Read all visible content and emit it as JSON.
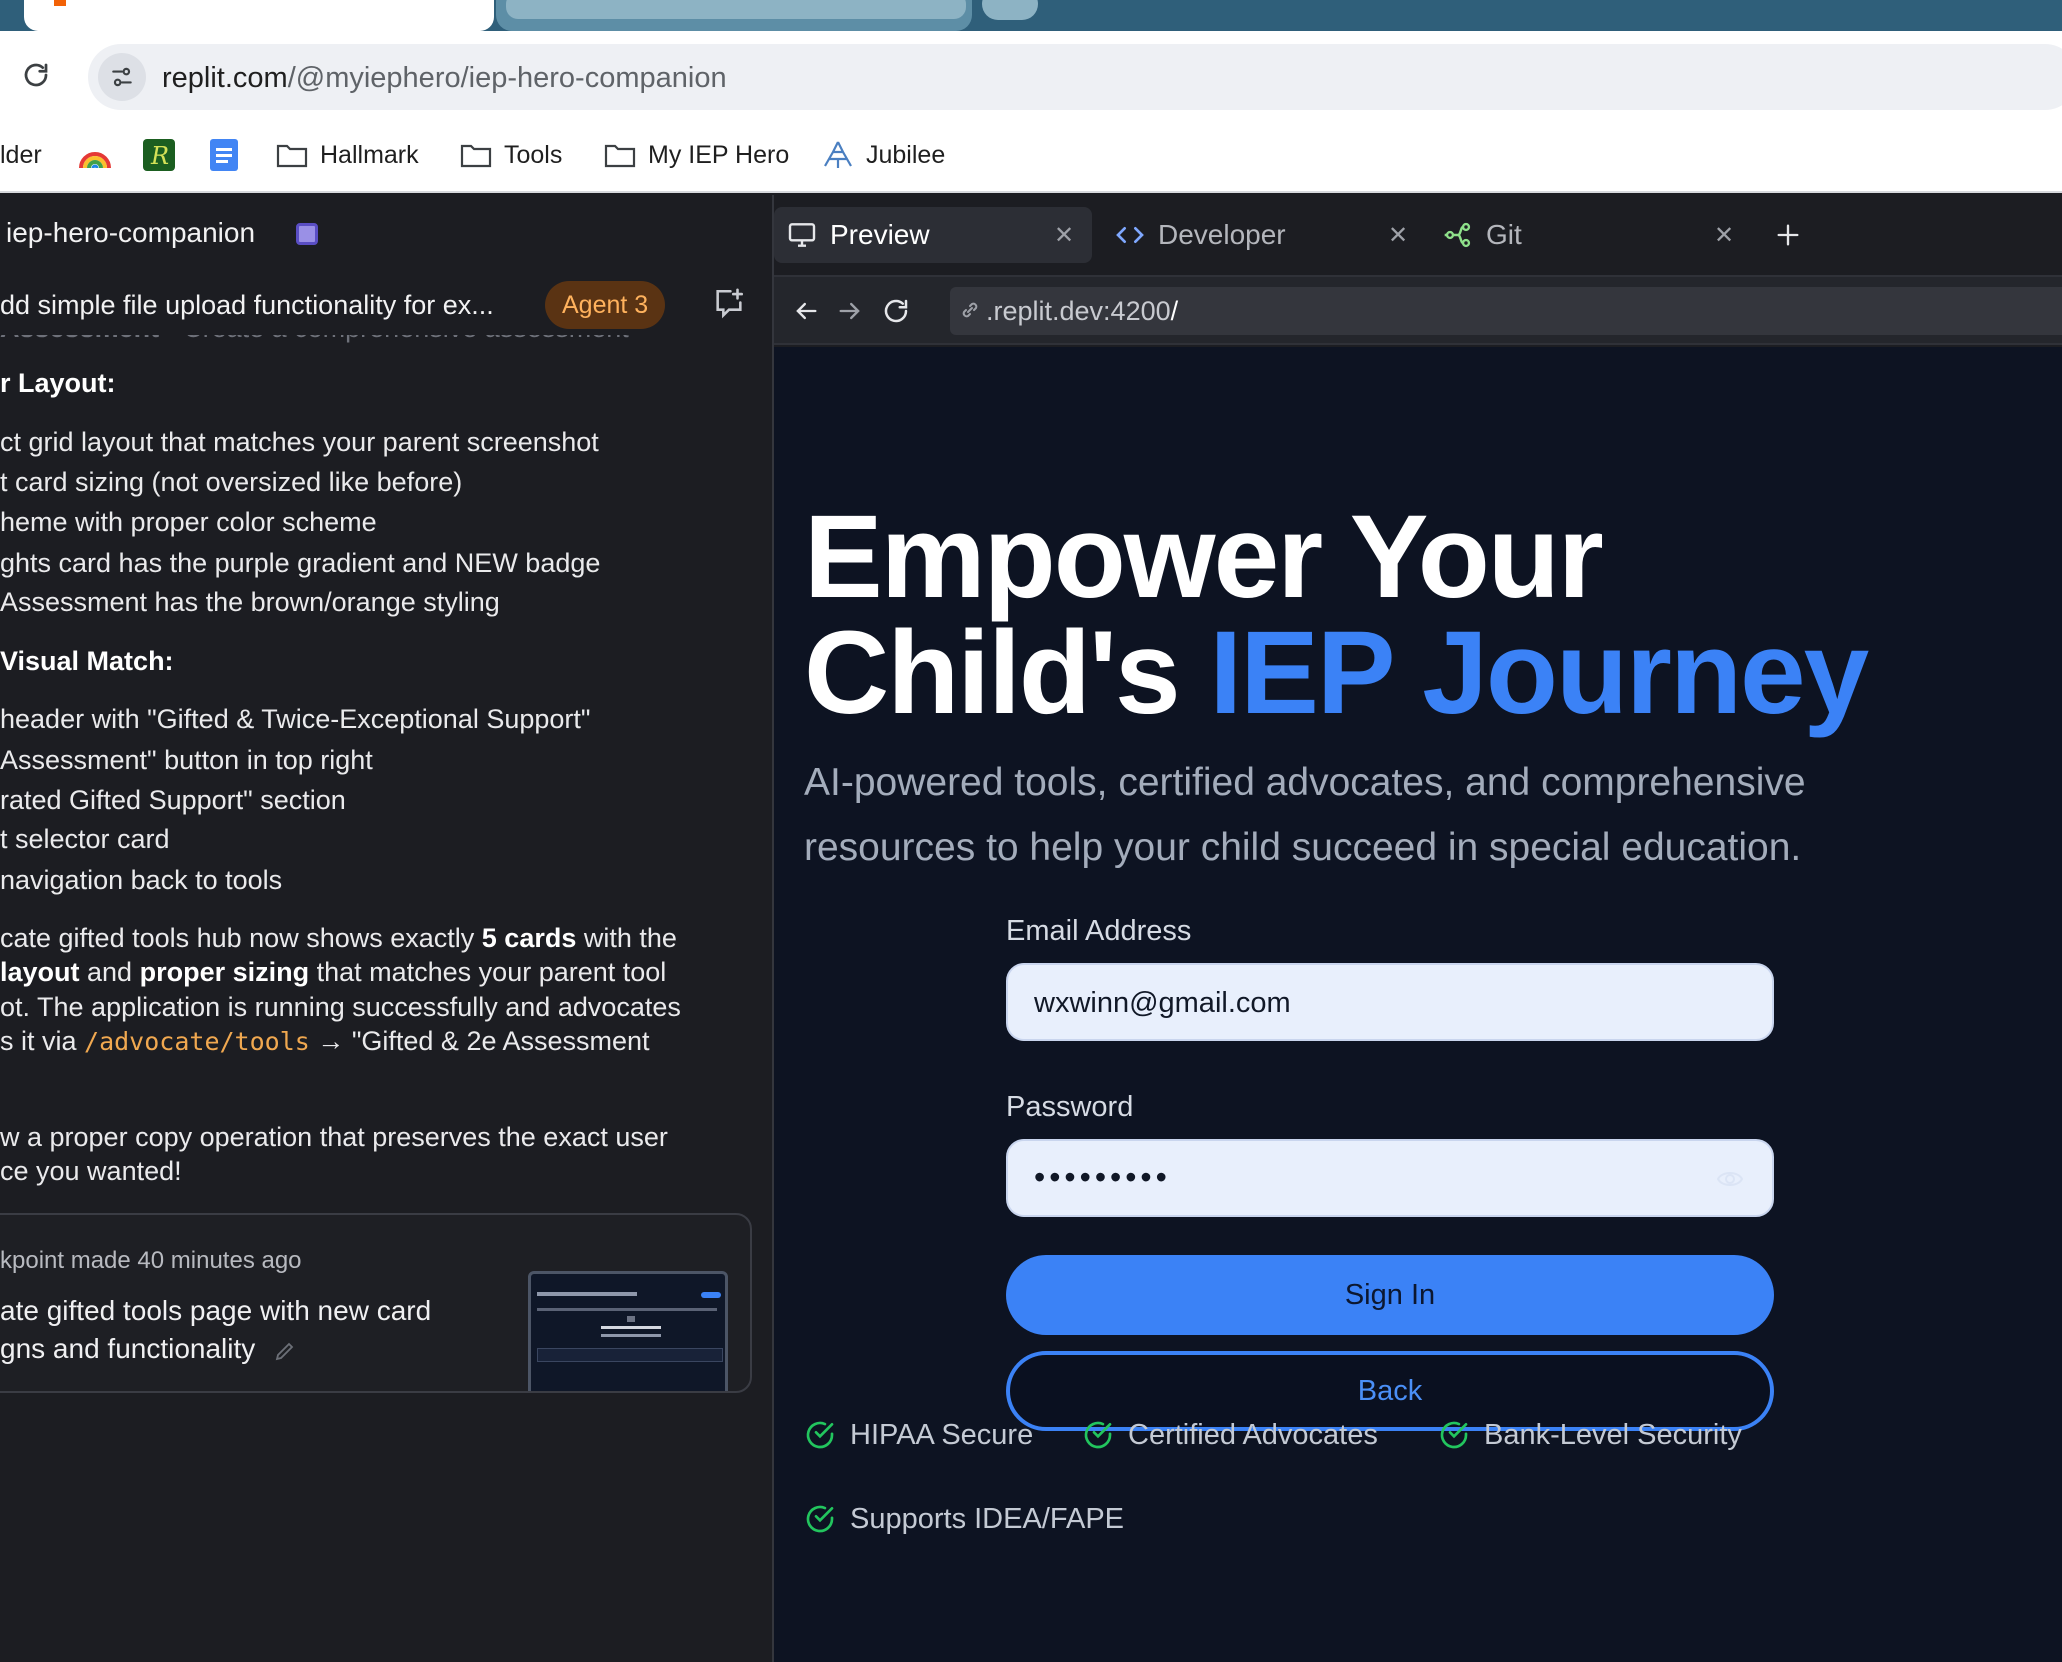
{
  "browser": {
    "url_host": "replit.com",
    "url_path": "/@myiephero/iep-hero-companion",
    "bookmarks": [
      {
        "label": "lder",
        "icon": "folder-icon"
      },
      {
        "label": "",
        "icon": "rainbow-icon"
      },
      {
        "label": "",
        "icon": "r-logo-icon"
      },
      {
        "label": "",
        "icon": "docs-icon"
      },
      {
        "label": "Hallmark",
        "icon": "folder-icon"
      },
      {
        "label": "Tools",
        "icon": "folder-icon"
      },
      {
        "label": "My IEP Hero",
        "icon": "folder-icon"
      },
      {
        "label": "Jubilee",
        "icon": "jubilee-icon"
      }
    ]
  },
  "agent_pane": {
    "project_name": "iep-hero-companion",
    "task_title": "dd simple file upload functionality for ex...",
    "agent_badge": "Agent 3",
    "faded_line": {
      "bold": "Assessment",
      "rest": " - Create a comprehensive assessment"
    },
    "heading_layout": "r Layout:",
    "layout_items": [
      "ct grid layout that matches your parent screenshot",
      "t card sizing (not oversized like before)",
      "heme with proper color scheme",
      "ghts card has the purple gradient and NEW badge",
      "Assessment has the brown/orange styling"
    ],
    "heading_visual": "Visual Match:",
    "visual_items": [
      "header with \"Gifted & Twice-Exceptional Support\"",
      "Assessment\" button in top right",
      "rated Gifted Support\" section",
      "t selector card",
      " navigation back to tools"
    ],
    "summary": {
      "l1_a": "cate gifted tools hub now shows exactly ",
      "l1_b": "5 cards",
      "l1_c": " with the",
      "l2_a": "layout",
      "l2_b": " and ",
      "l2_c": "proper sizing",
      "l2_d": " that matches your parent tool",
      "l3": "ot. The application is running successfully and advocates",
      "l4_a": "s it via ",
      "l4_code": "/advocate/tools",
      "l4_b": " → \"Gifted & 2e Assessment"
    },
    "closing": {
      "l1": "w a proper copy operation that preserves the exact user",
      "l2": "ce you wanted!"
    },
    "checkpoint": {
      "meta": "kpoint made 40 minutes ago",
      "title_l1": "ate gifted tools page with new card",
      "title_l2": "gns and functionality"
    }
  },
  "preview_pane": {
    "tabs": [
      {
        "label": "Preview",
        "icon": "monitor-icon"
      },
      {
        "label": "Developer",
        "icon": "code-icon"
      },
      {
        "label": "Git",
        "icon": "git-icon"
      }
    ],
    "address": {
      "prefix": ".replit.dev:4200",
      "suffix": "/"
    },
    "hero_line1": "Empower Your",
    "hero_line2_plain": "Child's ",
    "hero_line2_accent": "IEP Journey",
    "subtitle_l1": "AI-powered tools, certified advocates, and comprehensive",
    "subtitle_l2": "resources to help your child succeed in special education.",
    "form": {
      "email_label": "Email Address",
      "email_value": "wxwinn@gmail.com",
      "password_label": "Password",
      "password_masked": "•••••••••",
      "sign_in": "Sign In",
      "back": "Back"
    },
    "features": [
      "HIPAA Secure",
      "Certified Advocates",
      "Bank-Level Security",
      "Supports IDEA/FAPE"
    ],
    "colors": {
      "accent": "#3b82f6",
      "page_bg": "#0d1322",
      "check": "#22c55e"
    }
  }
}
